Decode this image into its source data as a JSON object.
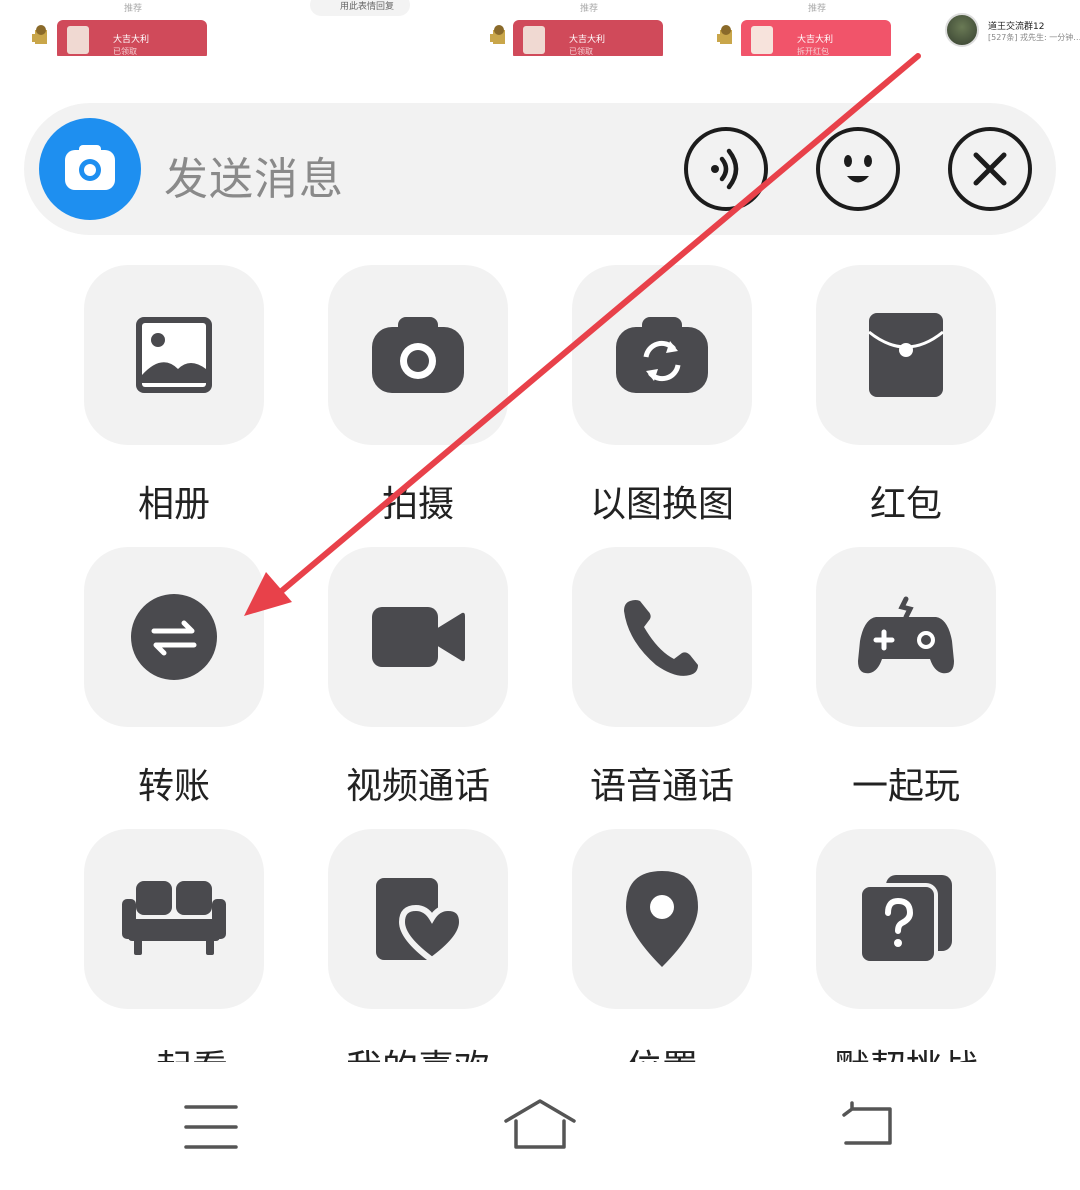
{
  "chat_strip": {
    "packets": [
      {
        "title": "大吉大利",
        "sub": "已领取"
      },
      {
        "title": "大吉大利",
        "sub": "已领取"
      },
      {
        "title": "大吉大利",
        "sub": "拆开红包"
      }
    ],
    "tiny_labels": [
      "推荐",
      "推荐",
      "推荐"
    ],
    "pill_text": "用此表情回复",
    "group": {
      "name": "道王交流群12",
      "last": "[527条] 戎先生: 一分钟……"
    }
  },
  "input_bar": {
    "placeholder": "发送消息"
  },
  "tools": [
    {
      "label": "相册",
      "icon": "album-icon"
    },
    {
      "label": "拍摄",
      "icon": "camera-icon"
    },
    {
      "label": "以图换图",
      "icon": "image-swap-icon"
    },
    {
      "label": "红包",
      "icon": "red-packet-icon"
    },
    {
      "label": "转账",
      "icon": "transfer-icon"
    },
    {
      "label": "视频通话",
      "icon": "video-call-icon"
    },
    {
      "label": "语音通话",
      "icon": "phone-icon"
    },
    {
      "label": "一起玩",
      "icon": "gamepad-icon"
    },
    {
      "label": "一起看",
      "icon": "sofa-icon"
    },
    {
      "label": "我的喜欢",
      "icon": "favorites-icon"
    },
    {
      "label": "位置",
      "icon": "location-pin-icon"
    },
    {
      "label": "默契挑战",
      "icon": "question-cards-icon"
    }
  ],
  "colors": {
    "accent_blue": "#1e8ff0",
    "icon_dark": "#4a4a4e",
    "tile_bg": "#f2f2f2",
    "annotation_red": "#e8414a"
  }
}
